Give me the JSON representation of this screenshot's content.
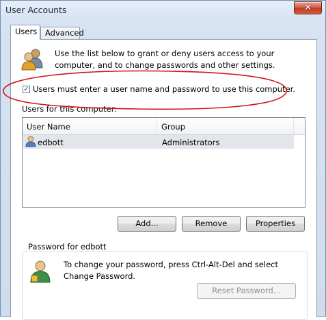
{
  "window": {
    "title": "User Accounts"
  },
  "tabs": [
    {
      "label": "Users",
      "selected": true
    },
    {
      "label": "Advanced",
      "selected": false
    }
  ],
  "intro_text": "Use the list below to grant or deny users access to your computer, and to change passwords and other settings.",
  "require_login": {
    "checked": true,
    "label": "Users must enter a user name and password to use this computer."
  },
  "users_section_label": "Users for this computer:",
  "user_list": {
    "columns": [
      "User Name",
      "Group"
    ],
    "rows": [
      {
        "name": "edbott",
        "group": "Administrators"
      }
    ]
  },
  "buttons": {
    "add": "Add...",
    "remove": "Remove",
    "properties": "Properties"
  },
  "password_group": {
    "title": "Password for edbott",
    "text": "To change your password, press Ctrl-Alt-Del and select Change Password.",
    "reset_button": "Reset Password...",
    "reset_enabled": false
  },
  "colors": {
    "annotation": "#d0141a",
    "selection": "#e2e5ea",
    "close_button": "#c8442c"
  },
  "icons": [
    "users-group-icon",
    "user-row-icon",
    "user-password-icon",
    "close-icon",
    "checkmark-icon"
  ]
}
